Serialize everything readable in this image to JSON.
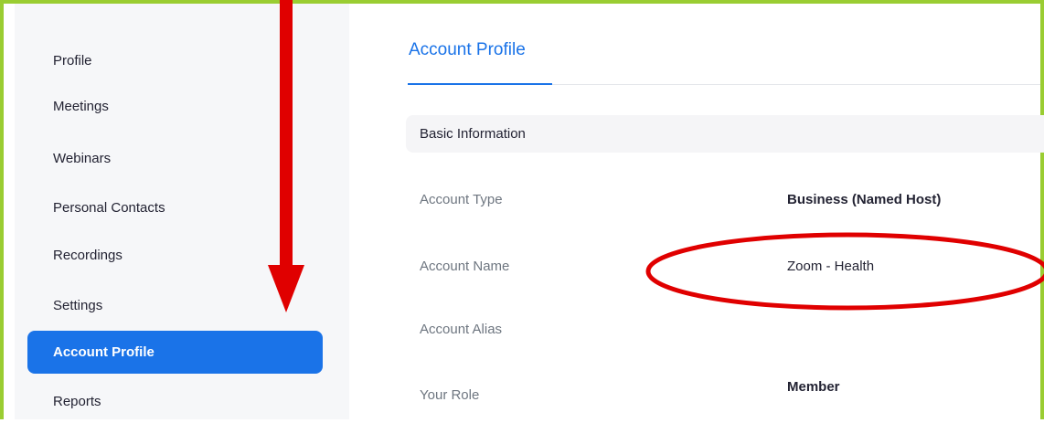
{
  "sidebar": {
    "items": [
      {
        "label": "Profile"
      },
      {
        "label": "Meetings"
      },
      {
        "label": "Webinars"
      },
      {
        "label": "Personal Contacts"
      },
      {
        "label": "Recordings"
      },
      {
        "label": "Settings"
      },
      {
        "label": "Account Profile",
        "active": true
      },
      {
        "label": "Reports"
      }
    ]
  },
  "main": {
    "title": "Account Profile",
    "section": "Basic Information",
    "fields": [
      {
        "label": "Account Type",
        "value": "Business (Named Host)"
      },
      {
        "label": "Account Name",
        "value": "Zoom - Health"
      },
      {
        "label": "Account Alias",
        "value": ""
      },
      {
        "label": "Your Role",
        "value": "Member"
      }
    ]
  },
  "colors": {
    "accent": "#1a73e8",
    "frame_border": "#9ACD32",
    "annotation": "#e00000",
    "sidebar_bg": "#f6f7f9"
  },
  "annotations": {
    "arrow": "red-down-arrow",
    "ellipse": "red-highlight-ellipse"
  }
}
